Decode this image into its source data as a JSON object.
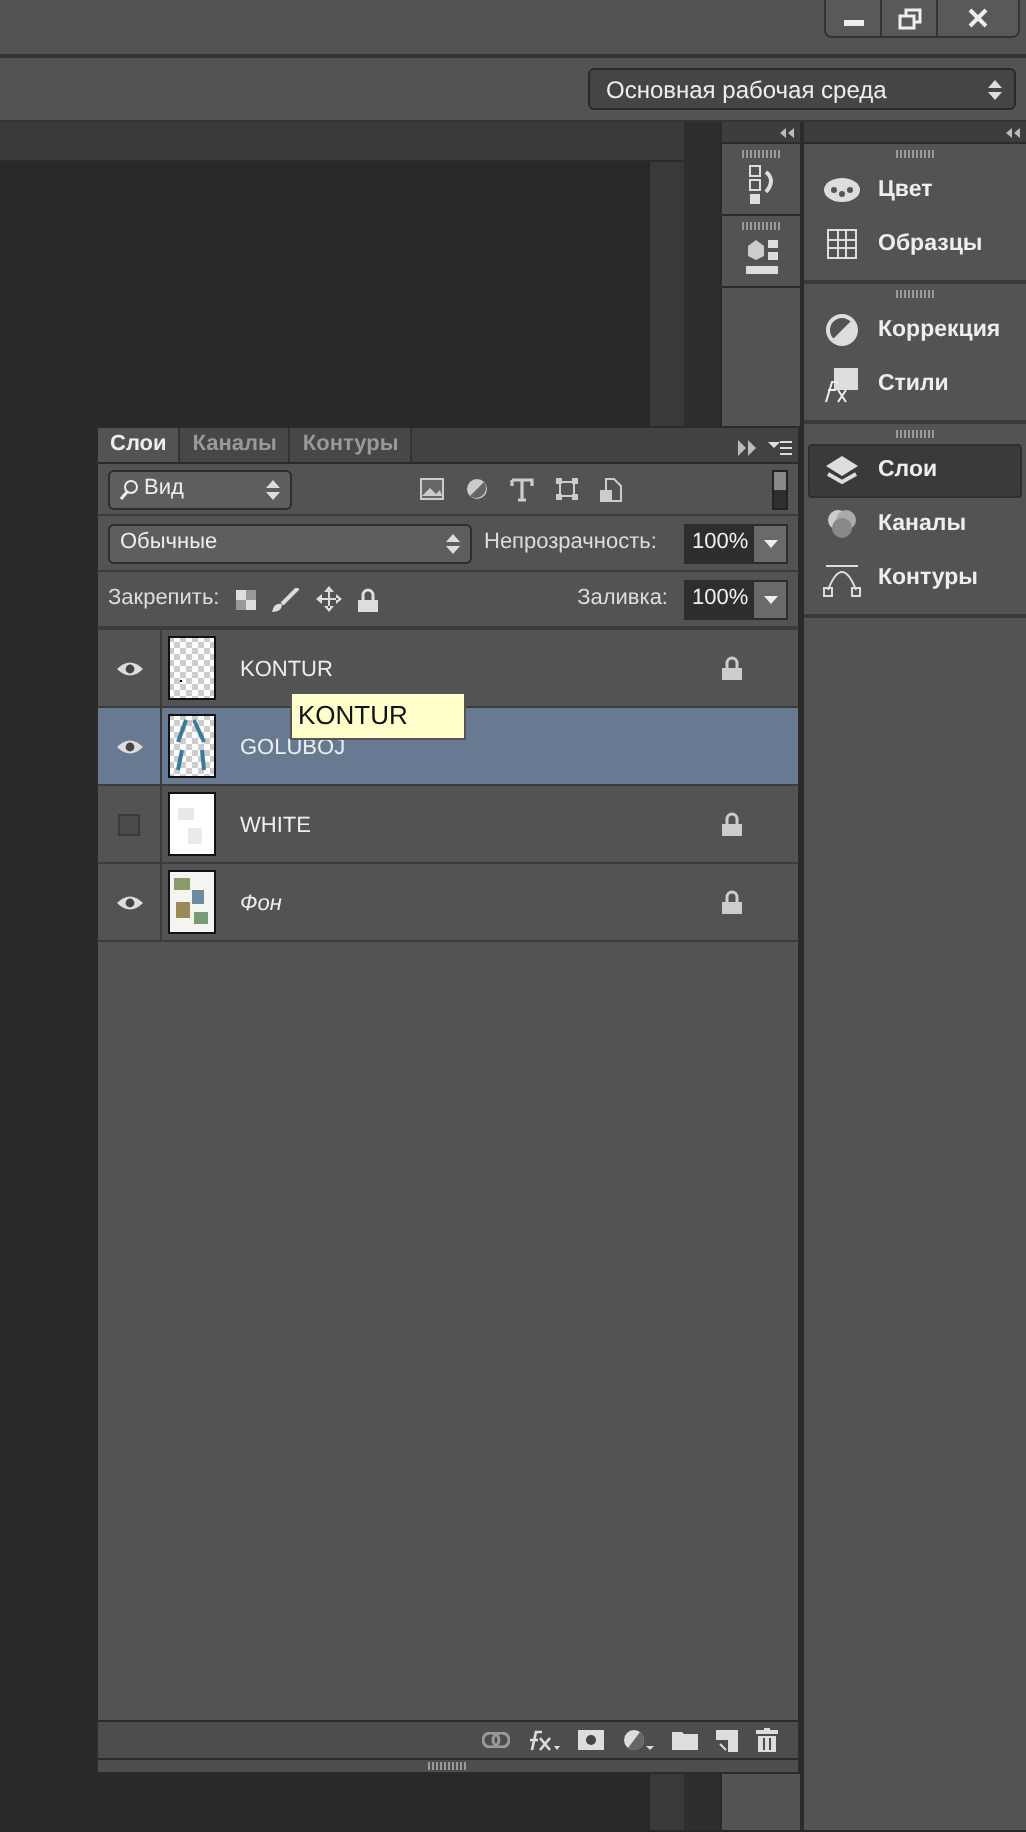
{
  "workspace": {
    "value": "Основная рабочая среда"
  },
  "panel_dock": {
    "groups": [
      [
        {
          "label": "Цвет",
          "selected": false
        },
        {
          "label": "Образцы",
          "selected": false
        }
      ],
      [
        {
          "label": "Коррекция",
          "selected": false
        },
        {
          "label": "Стили",
          "selected": false
        }
      ],
      [
        {
          "label": "Слои",
          "selected": true
        },
        {
          "label": "Каналы",
          "selected": false
        },
        {
          "label": "Контуры",
          "selected": false
        }
      ]
    ]
  },
  "layers_panel": {
    "tabs": [
      {
        "label": "Слои",
        "selected": true
      },
      {
        "label": "Каналы",
        "selected": false
      },
      {
        "label": "Контуры",
        "selected": false
      }
    ],
    "filter": "Вид",
    "blend_mode": "Обычные",
    "opacity_label": "Непрозрачность:",
    "opacity": "100%",
    "lock_label": "Закрепить:",
    "fill_label": "Заливка:",
    "fill": "100%",
    "layers": [
      {
        "name": "KONTUR",
        "kind": "layer",
        "visible": true,
        "locked": true,
        "selected": false
      },
      {
        "name": "GOLUBOJ",
        "kind": "layer",
        "visible": true,
        "locked": false,
        "selected": true
      },
      {
        "name": "WHITE",
        "kind": "layer",
        "visible": false,
        "locked": true,
        "selected": false
      },
      {
        "name": "Фон",
        "kind": "background",
        "visible": true,
        "locked": true,
        "selected": false
      }
    ]
  },
  "tooltip": {
    "text": "KONTUR"
  }
}
